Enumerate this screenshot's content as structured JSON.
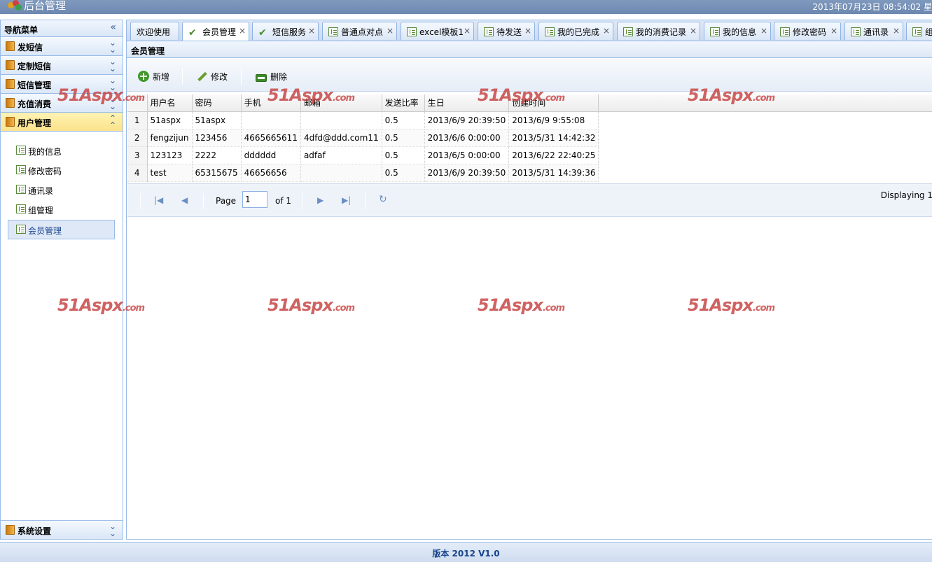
{
  "app": {
    "title": "后台管理",
    "datetime": "2013年07月23日 08:54:02 星"
  },
  "nav": {
    "header": "导航菜单",
    "sections": [
      {
        "label": "发短信"
      },
      {
        "label": "定制短信"
      },
      {
        "label": "短信管理"
      },
      {
        "label": "充值消费"
      },
      {
        "label": "用户管理"
      }
    ],
    "sub_items": [
      {
        "label": "我的信息"
      },
      {
        "label": "修改密码"
      },
      {
        "label": "通讯录"
      },
      {
        "label": "组管理"
      },
      {
        "label": "会员管理"
      }
    ],
    "bottom_section": "系统设置"
  },
  "tabs": [
    {
      "label": "欢迎使用",
      "icon": "none"
    },
    {
      "label": "会员管理",
      "icon": "check-icon"
    },
    {
      "label": "短信服务",
      "icon": "check-icon"
    },
    {
      "label": "普通点对点",
      "icon": "page-icon"
    },
    {
      "label": "excel模板1",
      "icon": "page-icon"
    },
    {
      "label": "待发送",
      "icon": "page-icon"
    },
    {
      "label": "我的已完成",
      "icon": "page-icon"
    },
    {
      "label": "我的消费记录",
      "icon": "page-icon"
    },
    {
      "label": "我的信息",
      "icon": "page-icon"
    },
    {
      "label": "修改密码",
      "icon": "page-icon"
    },
    {
      "label": "通讯录",
      "icon": "page-icon"
    },
    {
      "label": "组",
      "icon": "page-icon"
    }
  ],
  "close_glyph": "×",
  "panel": {
    "title": "会员管理"
  },
  "toolbar": {
    "add": "新增",
    "edit": "修改",
    "delete": "删除"
  },
  "grid": {
    "columns": [
      "用户名",
      "密码",
      "手机",
      "邮箱",
      "发送比率",
      "生日",
      "创建时间"
    ],
    "rows": [
      {
        "n": "1",
        "cells": [
          "51aspx",
          "51aspx",
          "",
          "",
          "0.5",
          "2013/6/9 20:39:50",
          "2013/6/9 9:55:08"
        ]
      },
      {
        "n": "2",
        "cells": [
          "fengzijun",
          "123456",
          "4665665611",
          "4dfd@ddd.com11",
          "0.5",
          "2013/6/6 0:00:00",
          "2013/5/31 14:42:32"
        ]
      },
      {
        "n": "3",
        "cells": [
          "123123",
          "2222",
          "dddddd",
          "adfaf",
          "0.5",
          "2013/6/5 0:00:00",
          "2013/6/22 22:40:25"
        ]
      },
      {
        "n": "4",
        "cells": [
          "test",
          "65315675",
          "46656656",
          "",
          "0.5",
          "2013/6/9 20:39:50",
          "2013/5/31 14:39:36"
        ]
      }
    ]
  },
  "pager": {
    "page_label": "Page",
    "current": "1",
    "of_label": "of 1",
    "display": "Displaying 1"
  },
  "watermark": {
    "main": "51Aspx",
    "suffix": ".com"
  },
  "footer": {
    "version": "版本 2012 V1.0"
  }
}
